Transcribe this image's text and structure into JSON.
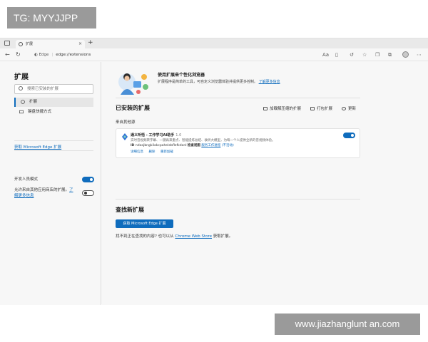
{
  "watermarks": {
    "top_left": "TG: MYYJJPP",
    "bottom_right": "www.jiazhanglunt an.com"
  },
  "browser": {
    "tab_title": "扩展",
    "new_tab_symbol": "+",
    "tab_close_symbol": "×",
    "address_prefix": "Edge",
    "address_url": "edge://extensions",
    "icons": [
      "back-icon",
      "refresh-icon",
      "split-screen-icon",
      "favorites-icon",
      "collections-icon",
      "extensions-icon",
      "downloads-icon",
      "profile-icon"
    ]
  },
  "sidebar": {
    "title": "扩展",
    "search_placeholder": "搜索已安装的扩展",
    "items": [
      {
        "label": "扩展",
        "icon": "extensions-icon",
        "active": true
      },
      {
        "label": "键盘快捷方式",
        "icon": "keyboard-icon",
        "active": false
      }
    ],
    "get_link": "获取 Microsoft Edge 扩展",
    "dev_mode_label": "开发人员模式",
    "dev_mode_on": true,
    "allow_other_stores_label": "允许来自其他应用商店的扩展。",
    "allow_other_stores_link_a": "了",
    "allow_other_stores_link_b": "解更多信息",
    "allow_other_stores_on": false
  },
  "main": {
    "promo_title": "使用扩展来个性化浏览器",
    "promo_desc": "扩展程序是简单的工具，可自定义浏览器体验并提供更多控制。",
    "promo_link": "了解更多信息",
    "installed_heading": "已安装的扩展",
    "actions": {
      "load_unpacked": "加载解压缩的扩展",
      "pack": "打包扩展",
      "update": "更新"
    },
    "source_label": "来自其他源",
    "extension": {
      "name": "通义听悟 - 工作学习AI助手",
      "version": "1.0",
      "desc": "实时音视频转字幕、一键再来重点、智能提炼总结、收听大模型，为每一个人提供全新的音视频体验。",
      "id_label": "ID",
      "id_value": "ndoojbngkilakcpahelebflefkdonl",
      "inspect_label": "检查视图",
      "inspect_link": "服务工作进程",
      "inspect_status": "(不活动)",
      "links": [
        "详细信息",
        "删除",
        "重新加载"
      ],
      "enabled": true
    },
    "find_heading": "查找新扩展",
    "get_button": "获取 Microsoft Edge 扩展",
    "find_text_pre": "找不到正在查找的内容? 也可以从",
    "find_text_link": "Chrome Web Store",
    "find_text_post": "获取扩展。"
  },
  "colors": {
    "accent": "#0f6cbd",
    "watermark_bg": "#9a9a9a"
  }
}
